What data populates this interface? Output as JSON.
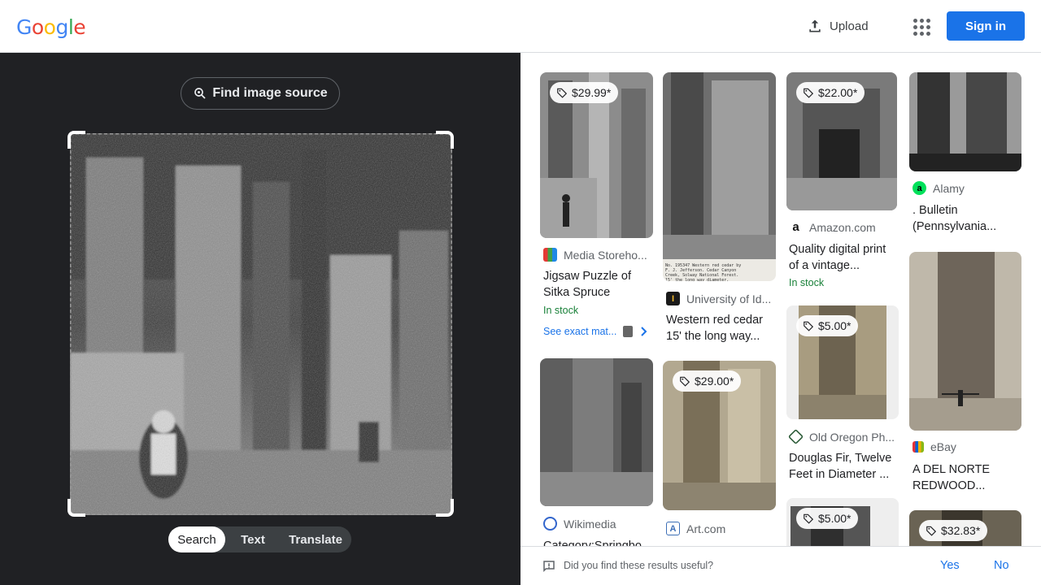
{
  "header": {
    "logo": [
      "G",
      "o",
      "o",
      "g",
      "l",
      "e"
    ],
    "logo_colors": [
      "#4285F4",
      "#EA4335",
      "#FBBC05",
      "#4285F4",
      "#34A853",
      "#EA4335"
    ],
    "upload_label": "Upload",
    "signin_label": "Sign in"
  },
  "lens": {
    "find_source_label": "Find image source",
    "modes": [
      "Search",
      "Text",
      "Translate"
    ],
    "active_mode": "Search"
  },
  "results": [
    {
      "price": "$29.99*",
      "source": "Media Storeho...",
      "title_lines": [
        "Jigsaw Puzzle of",
        "Sitka Spruce"
      ],
      "stock": "In stock",
      "exact_matches": "See exact mat..."
    },
    {
      "price": "",
      "source": "University of Id...",
      "title_lines": [
        "Western red cedar",
        "15' the long way..."
      ]
    },
    {
      "price": "$22.00*",
      "source": "Amazon.com",
      "title_lines": [
        "Quality digital print",
        "of a vintage..."
      ],
      "stock": "In stock"
    },
    {
      "price": "",
      "source": "Alamy",
      "title_lines": [
        ". Bulletin",
        "(Pennsylvania..."
      ]
    },
    {
      "price": "",
      "source": "Wikimedia",
      "title_lines": [
        "Category:Springbo..."
      ]
    },
    {
      "price": "$29.00*",
      "source": "Art.com",
      "title_lines": []
    },
    {
      "price": "$5.00*",
      "source": "Old Oregon Ph...",
      "title_lines": [
        "Douglas Fir, Twelve",
        "Feet in Diameter ..."
      ]
    },
    {
      "price": "",
      "source": "eBay",
      "title_lines": [
        "A DEL NORTE",
        "REDWOOD..."
      ]
    },
    {
      "price": "$5.00*",
      "source": "",
      "title_lines": []
    },
    {
      "price": "$32.83*",
      "source": "",
      "title_lines": []
    }
  ],
  "image_caption_text": "No. 195347 Western red cedar by F. J. Jefferson. Cedar Canyon Creek, Solway National Forest. 15' the long way diameter.",
  "feedback": {
    "question": "Did you find these results useful?",
    "yes": "Yes",
    "no": "No"
  },
  "colors": {
    "accent": "#1a73e8",
    "dark_pane": "#202124",
    "stock_green": "#188038"
  }
}
